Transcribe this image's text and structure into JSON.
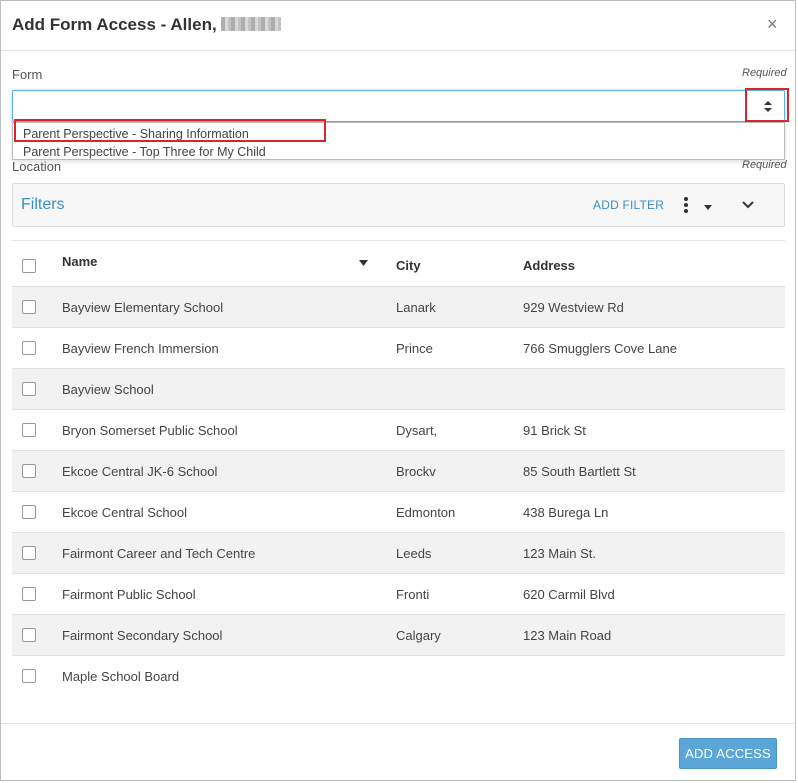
{
  "dialog": {
    "title": "Add Form Access - Allen,",
    "close_symbol": "×"
  },
  "form_field": {
    "label": "Form",
    "required_label": "Required",
    "value": "",
    "options": [
      "Parent Perspective - Sharing Information",
      "Parent Perspective - Top Three for My Child"
    ]
  },
  "location_field": {
    "label": "Location",
    "required_label": "Required"
  },
  "filters": {
    "title": "Filters",
    "add_filter_label": "ADD FILTER"
  },
  "table": {
    "columns": {
      "name": "Name",
      "city": "City",
      "address": "Address"
    },
    "rows": [
      {
        "name": "Bayview Elementary School",
        "city": "Lanark",
        "address": "929 Westview Rd"
      },
      {
        "name": "Bayview French Immersion",
        "city": "Prince",
        "address": "766 Smugglers Cove Lane"
      },
      {
        "name": "Bayview School",
        "city": "",
        "address": ""
      },
      {
        "name": "Bryon Somerset Public School",
        "city": "Dysart,",
        "address": "91 Brick St"
      },
      {
        "name": "Ekcoe Central JK-6 School",
        "city": "Brockv",
        "address": "85 South Bartlett St"
      },
      {
        "name": "Ekcoe Central School",
        "city": "Edmonton",
        "address": "438 Burega Ln"
      },
      {
        "name": "Fairmont Career and Tech Centre",
        "city": "Leeds",
        "address": "123 Main St."
      },
      {
        "name": "Fairmont Public School",
        "city": "Fronti",
        "address": "620 Carmil Blvd"
      },
      {
        "name": "Fairmont Secondary School",
        "city": "Calgary",
        "address": "123 Main Road"
      },
      {
        "name": "Maple School Board",
        "city": "",
        "address": ""
      }
    ]
  },
  "footer": {
    "add_access_label": "ADD ACCESS"
  },
  "colors": {
    "accent": "#3a8dc4",
    "primary_button": "#5aa6d6",
    "highlight_box": "#d9262b"
  }
}
